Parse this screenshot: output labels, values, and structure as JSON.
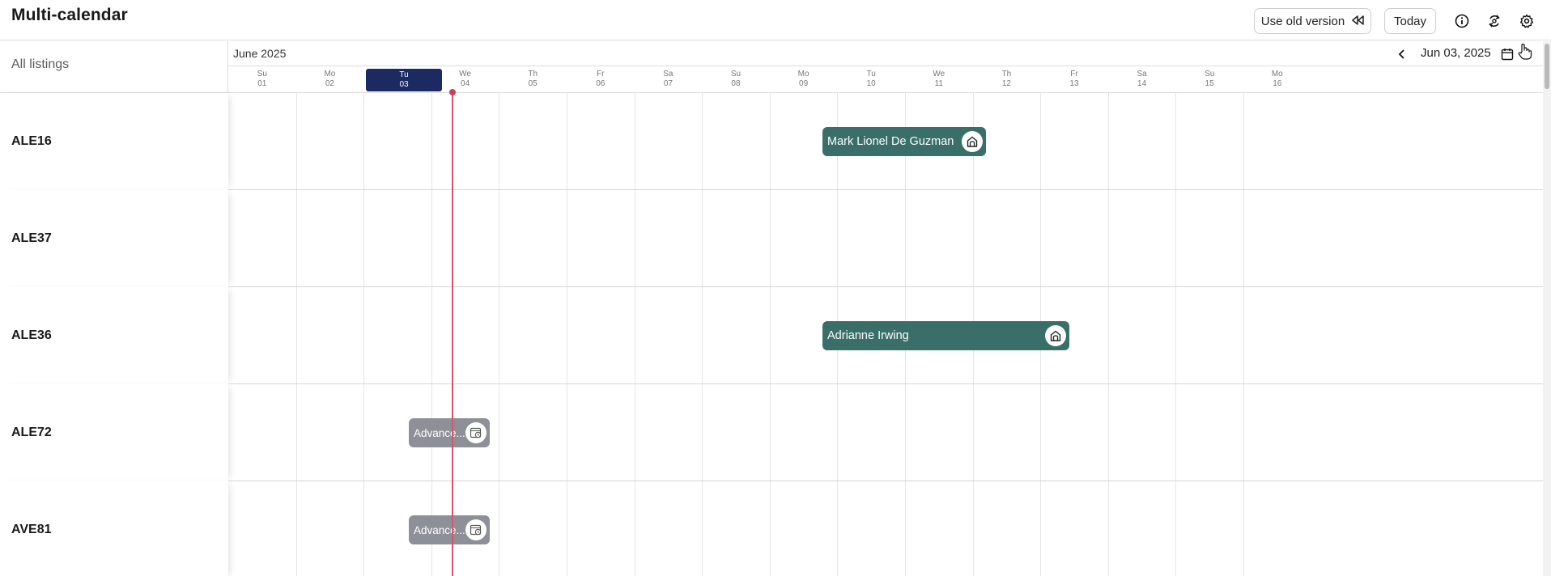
{
  "header": {
    "title": "Multi-calendar",
    "use_old_version_label": "Use old version",
    "today_label": "Today"
  },
  "calendar": {
    "left_header": "All listings",
    "month_label": "June 2025",
    "current_date": "Jun 03, 2025",
    "days": [
      {
        "name": "Su",
        "date": "01"
      },
      {
        "name": "Mo",
        "date": "02"
      },
      {
        "name": "Tu",
        "date": "03",
        "today": true
      },
      {
        "name": "We",
        "date": "04"
      },
      {
        "name": "Th",
        "date": "05"
      },
      {
        "name": "Fr",
        "date": "06"
      },
      {
        "name": "Sa",
        "date": "07"
      },
      {
        "name": "Su",
        "date": "08"
      },
      {
        "name": "Mo",
        "date": "09"
      },
      {
        "name": "Tu",
        "date": "10"
      },
      {
        "name": "We",
        "date": "11"
      },
      {
        "name": "Th",
        "date": "12"
      },
      {
        "name": "Fr",
        "date": "13"
      },
      {
        "name": "Sa",
        "date": "14"
      },
      {
        "name": "Su",
        "date": "15"
      },
      {
        "name": "Mo",
        "date": "16"
      }
    ]
  },
  "listings": [
    {
      "name": "ALE16"
    },
    {
      "name": "ALE37"
    },
    {
      "name": "ALE36"
    },
    {
      "name": "ALE72"
    },
    {
      "name": "AVE81"
    }
  ],
  "bookings": [
    {
      "label": "Mark Lionel De Guzman",
      "listing": "ALE16",
      "color": "#3a6e68",
      "icon": "home-icon"
    },
    {
      "label": "Adrianne Irwing",
      "listing": "ALE36",
      "color": "#3a6e68",
      "icon": "home-icon"
    },
    {
      "label": "Advance...",
      "listing": "ALE72",
      "color": "#8e9097",
      "icon": "calendar-clock-icon"
    },
    {
      "label": "Advance...",
      "listing": "AVE81",
      "color": "#8e9097",
      "icon": "calendar-clock-icon"
    }
  ],
  "colors": {
    "today_highlight": "#1c2a62",
    "today_line": "#d9536b",
    "booking_green": "#3a6e68",
    "booking_grey": "#8e9097"
  },
  "icons": [
    "rewind-icon",
    "info-icon",
    "sync-icon",
    "gear-icon",
    "chevron-left-icon",
    "calendar-icon",
    "home-icon",
    "calendar-clock-icon"
  ]
}
